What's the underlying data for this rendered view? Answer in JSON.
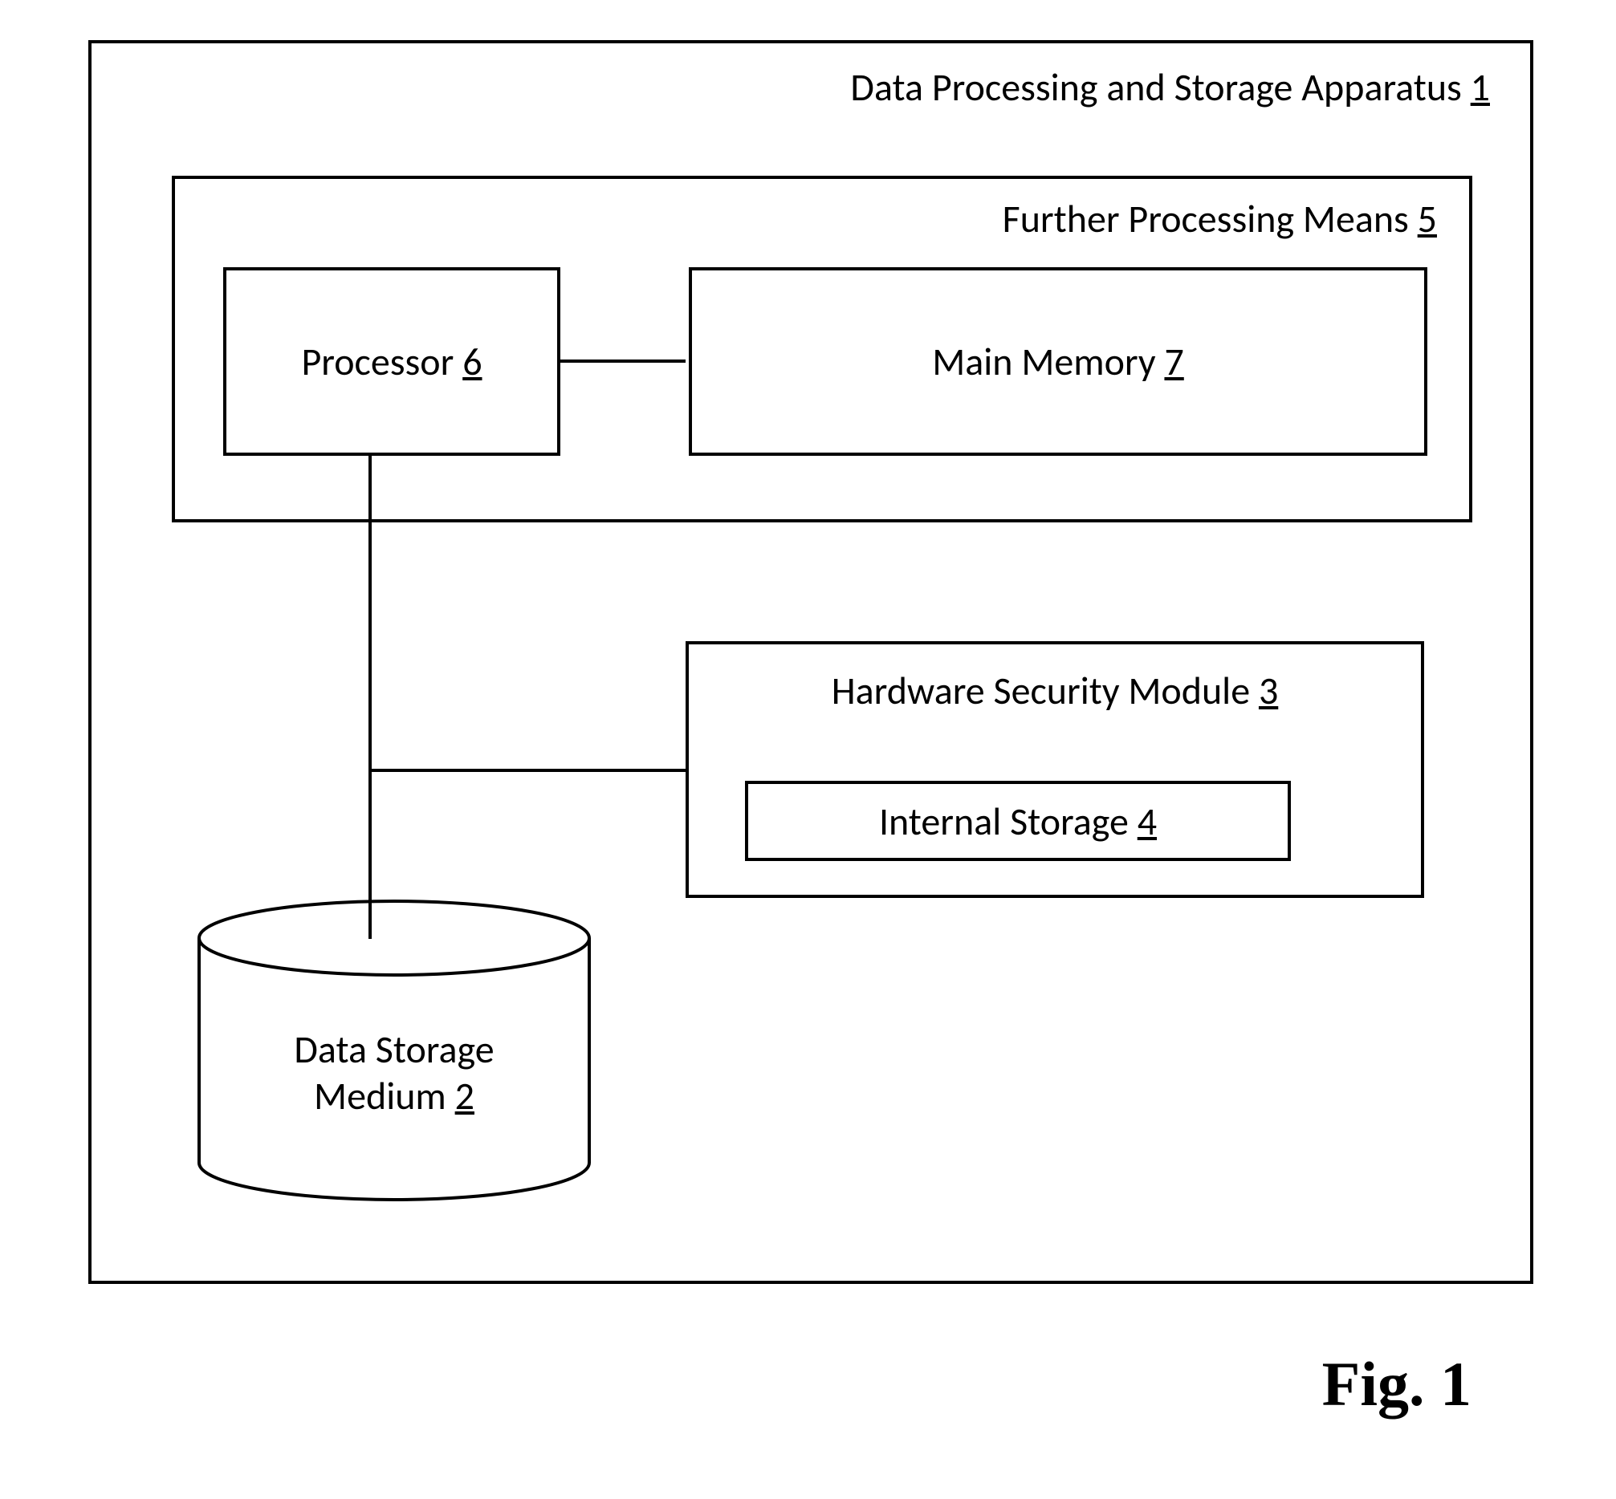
{
  "diagram": {
    "outer": {
      "label": "Data Processing and Storage Apparatus ",
      "num": "1"
    },
    "further": {
      "label": "Further Processing Means ",
      "num": "5"
    },
    "processor": {
      "label": "Processor ",
      "num": "6"
    },
    "memory": {
      "label": "Main Memory ",
      "num": "7"
    },
    "hsm": {
      "label": "Hardware Security Module ",
      "num": "3"
    },
    "internal_storage": {
      "label": "Internal  Storage ",
      "num": "4"
    },
    "data_storage": {
      "label_line1": "Data Storage",
      "label_line2": "Medium ",
      "num": "2"
    }
  },
  "figure_label": "Fig. 1"
}
